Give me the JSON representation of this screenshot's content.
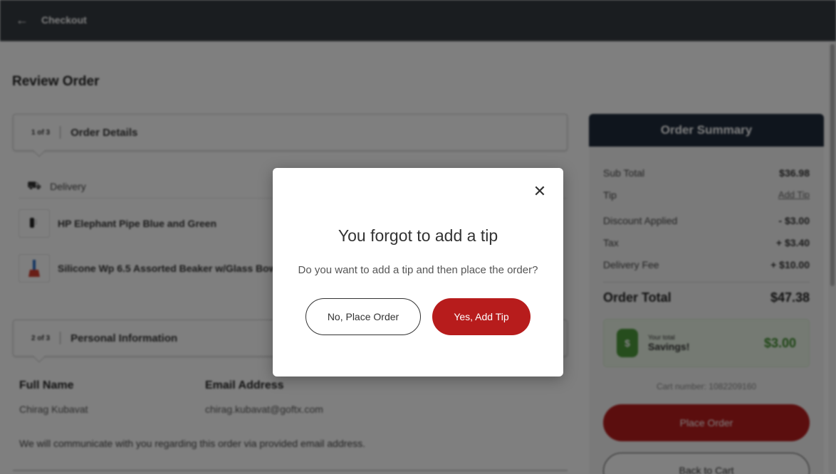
{
  "header": {
    "title": "Checkout",
    "back_icon": "arrow-left-icon"
  },
  "main": {
    "page_title": "Review Order",
    "steps": [
      {
        "step": "1 of 3",
        "label": "Order Details"
      },
      {
        "step": "2 of 3",
        "label": "Personal Information"
      }
    ],
    "delivery_label": "Delivery",
    "items": [
      {
        "name": "HP Elephant Pipe Blue and Green"
      },
      {
        "name": "Silicone Wp 6.5 Assorted Beaker w/Glass Bowl"
      }
    ],
    "personal": {
      "full_name_label": "Full Name",
      "full_name_value": "Chirag Kubavat",
      "email_label": "Email Address",
      "email_value": "chirag.kubavat@goftx.com",
      "communication_note": "We will communicate with you regarding this order via provided email address."
    }
  },
  "summary": {
    "title": "Order Summary",
    "rows": [
      {
        "label": "Sub Total",
        "value": "$36.98"
      },
      {
        "label": "Tip",
        "value": "Add Tip"
      },
      {
        "label": "Discount Applied",
        "value": "- $3.00"
      },
      {
        "label": "Tax",
        "value": "+ $3.40"
      },
      {
        "label": "Delivery Fee",
        "value": "+ $10.00"
      }
    ],
    "total_label": "Order Total",
    "total_value": "$47.38",
    "savings_small": "Your total",
    "savings_big": "Savings!",
    "savings_amount": "$3.00",
    "cart_number": "Cart number: 1082209160",
    "place_order": "Place Order",
    "back_to_cart": "Back to Cart",
    "colors": {
      "header_bg": "#1e2a3a",
      "accent": "#b71c1c",
      "savings": "#3d8b2a"
    }
  },
  "modal": {
    "title": "You forgot to add a tip",
    "message": "Do you want to add a tip and then place the order?",
    "no_button": "No, Place Order",
    "yes_button": "Yes, Add Tip",
    "close_icon": "close-icon"
  }
}
